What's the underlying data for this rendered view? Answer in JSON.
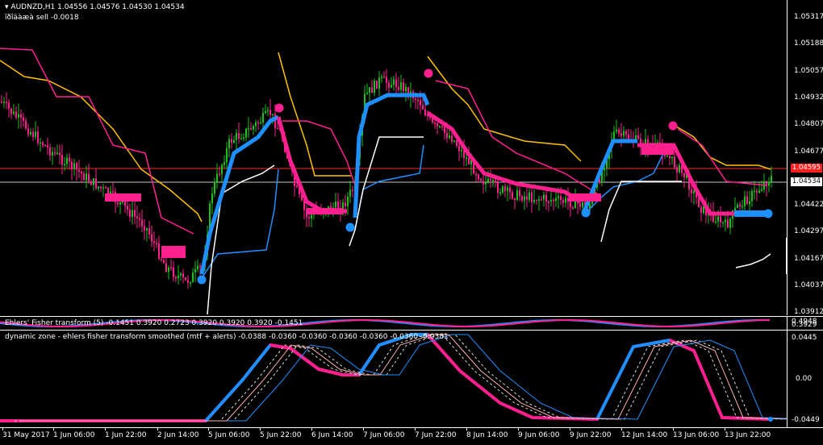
{
  "main": {
    "header_line1": "AUDNZD,H1  1.04556 1.04576 1.04530 1.04534",
    "header_line2": "ïðîäàæà sell -0.0018",
    "price_labels": [
      "1.05317",
      "1.05188",
      "1.05057",
      "1.04932",
      "1.04807",
      "1.04677",
      "1.04422",
      "1.04297",
      "1.04167",
      "1.04037",
      "1.03912"
    ],
    "red_price_badge": "1.04595",
    "current_price_badge": "1.04534",
    "colors": {
      "bull": "#19c319",
      "bear": "#ff1f8f",
      "buy": "#1e8fff",
      "sell": "#ff1f8f",
      "trail": "#ffc000",
      "white": "#ffffff"
    }
  },
  "pane1": {
    "title": "Ehlers' Fisher transform (5)  -0.1451  0.3920  0.2723  0.3920  0.3920  0.3920  -0.1451",
    "scale_labels": [
      "0.4948",
      "0.3929"
    ]
  },
  "pane2": {
    "title": "dynamic zone - ehlers fisher transform smoothed (mtf + alerts)  -0.0388  -0.0360  -0.0360  -0.0360  -0.0360  -0.0360  -0.0381",
    "scale_labels": [
      "0.0445",
      "0.00",
      "-0.0449"
    ]
  },
  "time_axis": [
    "31 May 2017",
    "1 Jun 06:00",
    "1 Jun 22:00",
    "2 Jun 14:00",
    "5 Jun 06:00",
    "5 Jun 22:00",
    "6 Jun 14:00",
    "7 Jun 06:00",
    "7 Jun 22:00",
    "8 Jun 14:00",
    "9 Jun 06:00",
    "9 Jun 22:00",
    "12 Jun 14:00",
    "13 Jun 06:00",
    "13 Jun 22:00"
  ]
}
